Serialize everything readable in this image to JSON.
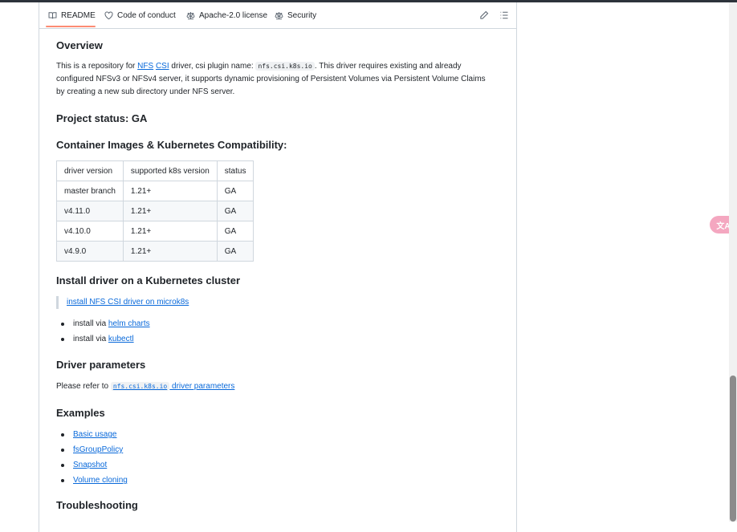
{
  "tabs": [
    {
      "label": "README",
      "icon": "book-icon"
    },
    {
      "label": "Code of conduct",
      "icon": "heart-icon"
    },
    {
      "label": "Apache-2.0 license",
      "icon": "law-icon"
    },
    {
      "label": "Security",
      "icon": "law-icon"
    }
  ],
  "toolbar": {
    "edit_icon": "pencil-icon",
    "outline_icon": "list-icon"
  },
  "overview": {
    "heading": "Overview",
    "p1": "This is a repository for ",
    "link_nfs": "NFS",
    "link_csi": "CSI",
    "p2": " driver, csi plugin name: ",
    "code": "nfs.csi.k8s.io",
    "p3": ". This driver requires existing and already configured NFSv3 or NFSv4 server, it supports dynamic provisioning of Persistent Volumes via Persistent Volume Claims by creating a new sub directory under NFS server."
  },
  "project_status": "Project status: GA",
  "compat": {
    "heading": "Container Images & Kubernetes Compatibility:",
    "headers": [
      "driver version",
      "supported k8s version",
      "status"
    ],
    "rows": [
      [
        "master branch",
        "1.21+",
        "GA"
      ],
      [
        "v4.11.0",
        "1.21+",
        "GA"
      ],
      [
        "v4.10.0",
        "1.21+",
        "GA"
      ],
      [
        "v4.9.0",
        "1.21+",
        "GA"
      ]
    ]
  },
  "install": {
    "heading": "Install driver on a Kubernetes cluster",
    "quote_link": "install NFS CSI driver on microk8s",
    "items": [
      {
        "prefix": "install via ",
        "link": "helm charts"
      },
      {
        "prefix": "install via ",
        "link": "kubectl"
      }
    ]
  },
  "params": {
    "heading": "Driver parameters",
    "text": "Please refer to ",
    "code": "nfs.csi.k8s.io",
    "link": " driver parameters"
  },
  "examples": {
    "heading": "Examples",
    "items": [
      "Basic usage",
      "fsGroupPolicy",
      "Snapshot",
      "Volume cloning"
    ]
  },
  "troubleshooting": {
    "heading": "Troubleshooting"
  },
  "translate_badge": "文A"
}
